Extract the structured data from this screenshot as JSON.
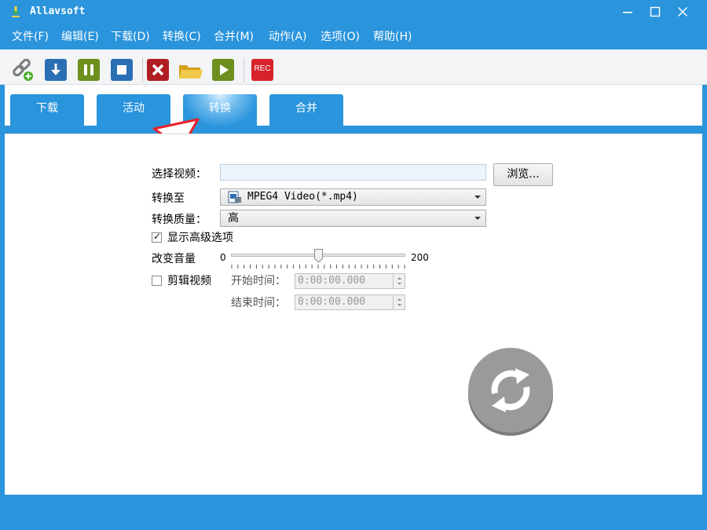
{
  "window": {
    "title": "Allavsoft"
  },
  "colors": {
    "accent": "#2a94dc",
    "toolbar_bg": "#f2f4f6",
    "annotation": "#e8212b"
  },
  "menu": [
    {
      "label": "文件(F)"
    },
    {
      "label": "编辑(E)"
    },
    {
      "label": "下载(D)"
    },
    {
      "label": "转换(C)"
    },
    {
      "label": "合并(M)"
    },
    {
      "label": "动作(A)"
    },
    {
      "label": "选项(O)"
    },
    {
      "label": "帮助(H)"
    }
  ],
  "toolbar": {
    "icons": [
      "add-link-icon",
      "download-icon",
      "pause-icon",
      "stop-icon",
      "delete-icon",
      "folder-icon",
      "play-icon",
      "record-icon"
    ],
    "rec_label": "REC"
  },
  "tabs": [
    {
      "label": "下载",
      "active": false
    },
    {
      "label": "活动",
      "active": false
    },
    {
      "label": "转换",
      "active": true
    },
    {
      "label": "合并",
      "active": false
    }
  ],
  "convert": {
    "select_video_label": "选择视频：",
    "select_video_value": "",
    "browse_label": "浏览...",
    "convert_to_label": "转换至",
    "format_value": "MPEG4 Video(*.mp4)",
    "quality_label": "转换质量：",
    "quality_value": "高",
    "show_advanced_label": "显示高级选项",
    "show_advanced_checked": true,
    "volume_label": "改变音量",
    "volume_min": "0",
    "volume_max": "200",
    "volume_value": 100,
    "trim_label": "剪辑视频",
    "trim_checked": false,
    "start_time_label": "开始时间：",
    "start_time_value": "0:00:00.000",
    "end_time_label": "结束时间：",
    "end_time_value": "0:00:00.000"
  }
}
